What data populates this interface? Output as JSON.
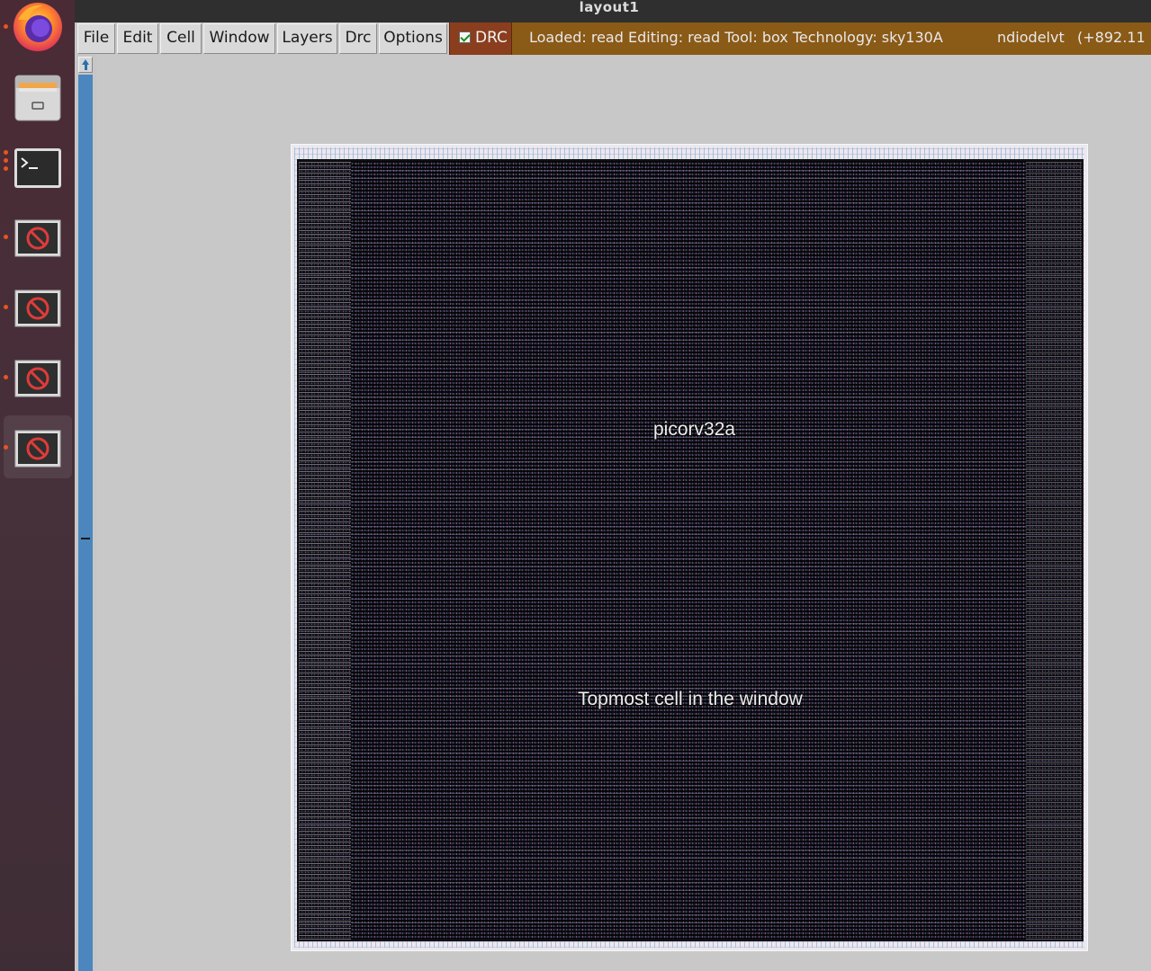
{
  "window": {
    "title": "layout1"
  },
  "dock": {
    "items": [
      {
        "name": "firefox-icon",
        "running": true
      },
      {
        "name": "files-icon",
        "running": false
      },
      {
        "name": "terminal-icon",
        "running": true
      },
      {
        "name": "no-entry-icon",
        "running": true
      },
      {
        "name": "no-entry-icon",
        "running": true
      },
      {
        "name": "no-entry-icon",
        "running": true
      },
      {
        "name": "no-entry-icon",
        "running": true
      }
    ]
  },
  "menubar": {
    "items": [
      "File",
      "Edit",
      "Cell",
      "Window",
      "Layers",
      "Drc",
      "Options"
    ],
    "drc_toggle": {
      "label": "DRC",
      "checked": true
    },
    "status": {
      "loaded": "Loaded: read Editing: read Tool: box  Technology: sky130A",
      "cell": "ndiodelvt",
      "coords": "(+892.11"
    }
  },
  "canvas": {
    "cell_name_label": "picorv32a",
    "cell_caption": "Topmost cell in the window"
  },
  "colors": {
    "menu_status_bg": "#8a5a17",
    "drc_bg": "#8a3e1d",
    "canvas_bg": "#c8c8c8",
    "scroll_track": "#4b86bf",
    "dock_bg": "#4a2b35",
    "accent_running": "#e95420"
  }
}
